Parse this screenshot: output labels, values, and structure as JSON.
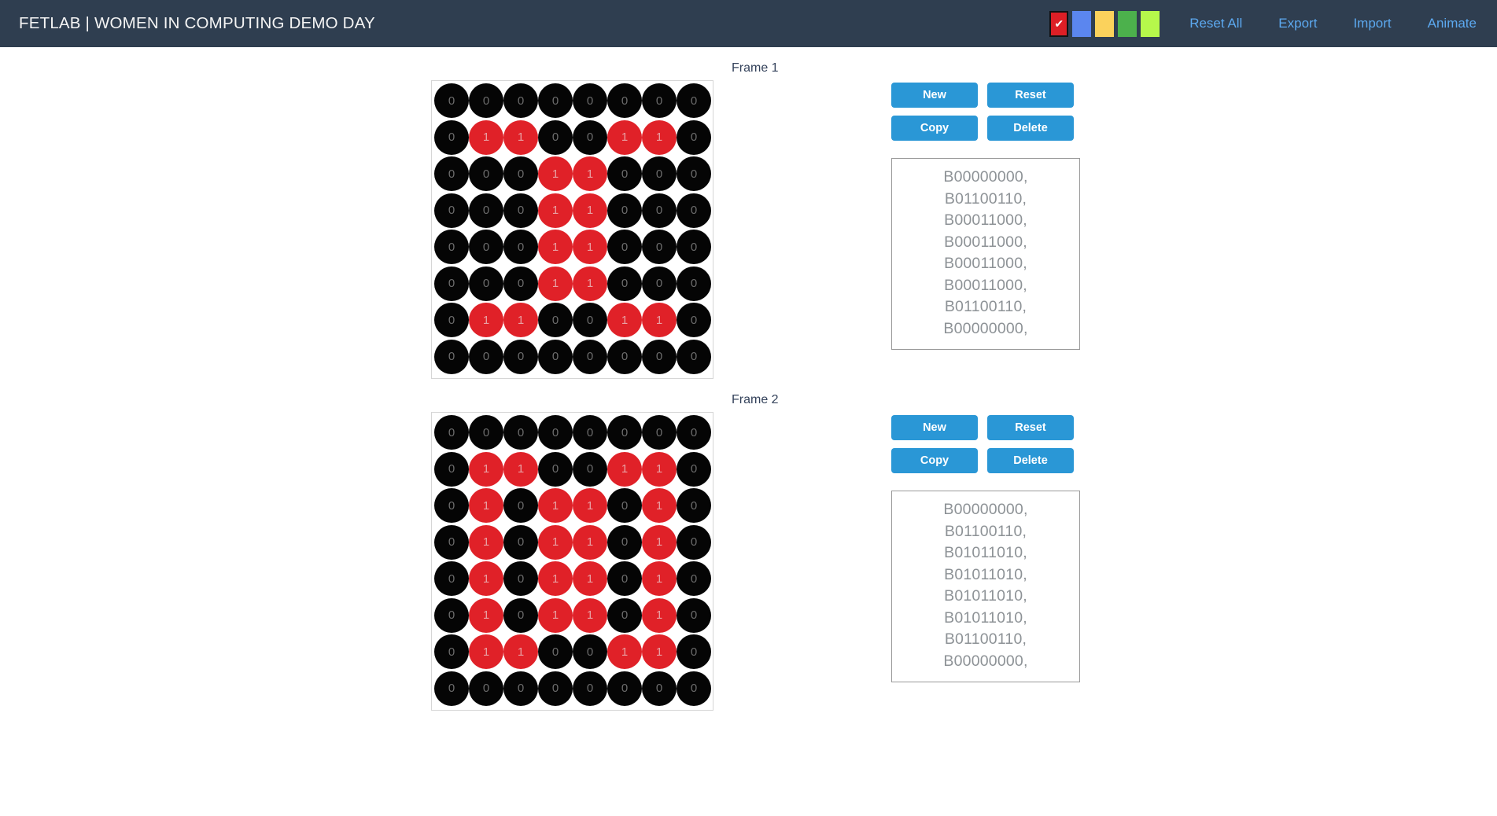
{
  "navbar": {
    "brand": "FETLAB | WOMEN IN COMPUTING DEMO DAY",
    "swatches": [
      {
        "name": "color-swatch-red",
        "color": "#dd1f26",
        "selected": true,
        "check": "✔"
      },
      {
        "name": "color-swatch-blue",
        "color": "#5b86ef",
        "selected": false,
        "check": ""
      },
      {
        "name": "color-swatch-yellow",
        "color": "#fbd25c",
        "selected": false,
        "check": ""
      },
      {
        "name": "color-swatch-green",
        "color": "#4cb14c",
        "selected": false,
        "check": ""
      },
      {
        "name": "color-swatch-lightgreen",
        "color": "#b6f84b",
        "selected": false,
        "check": ""
      }
    ],
    "links": [
      {
        "name": "nav-link-reset-all",
        "label": "Reset All"
      },
      {
        "name": "nav-link-export",
        "label": "Export"
      },
      {
        "name": "nav-link-import",
        "label": "Import"
      },
      {
        "name": "nav-link-animate",
        "label": "Animate"
      }
    ]
  },
  "buttons": {
    "new": "New",
    "reset": "Reset",
    "copy": "Copy",
    "delete": "Delete"
  },
  "frames": [
    {
      "label": "Frame 1",
      "grid": [
        [
          0,
          0,
          0,
          0,
          0,
          0,
          0,
          0
        ],
        [
          0,
          1,
          1,
          0,
          0,
          1,
          1,
          0
        ],
        [
          0,
          0,
          0,
          1,
          1,
          0,
          0,
          0
        ],
        [
          0,
          0,
          0,
          1,
          1,
          0,
          0,
          0
        ],
        [
          0,
          0,
          0,
          1,
          1,
          0,
          0,
          0
        ],
        [
          0,
          0,
          0,
          1,
          1,
          0,
          0,
          0
        ],
        [
          0,
          1,
          1,
          0,
          0,
          1,
          1,
          0
        ],
        [
          0,
          0,
          0,
          0,
          0,
          0,
          0,
          0
        ]
      ],
      "code": [
        "B00000000,",
        "B01100110,",
        "B00011000,",
        "B00011000,",
        "B00011000,",
        "B00011000,",
        "B01100110,",
        "B00000000,"
      ]
    },
    {
      "label": "Frame 2",
      "grid": [
        [
          0,
          0,
          0,
          0,
          0,
          0,
          0,
          0
        ],
        [
          0,
          1,
          1,
          0,
          0,
          1,
          1,
          0
        ],
        [
          0,
          1,
          0,
          1,
          1,
          0,
          1,
          0
        ],
        [
          0,
          1,
          0,
          1,
          1,
          0,
          1,
          0
        ],
        [
          0,
          1,
          0,
          1,
          1,
          0,
          1,
          0
        ],
        [
          0,
          1,
          0,
          1,
          1,
          0,
          1,
          0
        ],
        [
          0,
          1,
          1,
          0,
          0,
          1,
          1,
          0
        ],
        [
          0,
          0,
          0,
          0,
          0,
          0,
          0,
          0
        ]
      ],
      "code": [
        "B00000000,",
        "B01100110,",
        "B01011010,",
        "B01011010,",
        "B01011010,",
        "B01011010,",
        "B01100110,",
        "B00000000,"
      ]
    }
  ],
  "colors": {
    "navbar_bg": "#2f3e50",
    "led_on": "#e02128",
    "led_off": "#050505",
    "button_blue": "#2a97d6",
    "link_blue": "#5ca9f0",
    "code_text": "#8d9296"
  }
}
